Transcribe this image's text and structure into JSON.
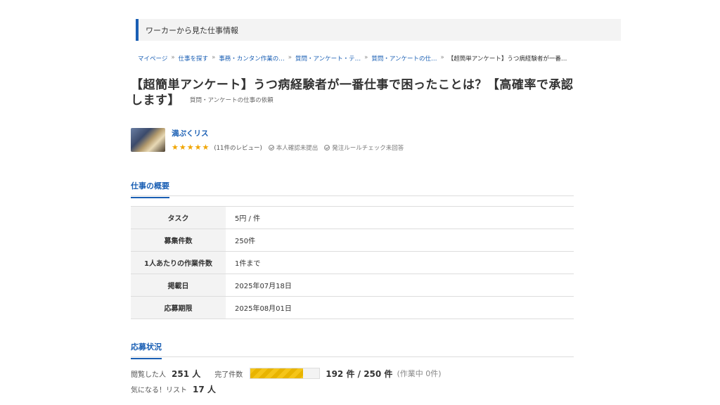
{
  "header": {
    "title": "ワーカーから見た仕事情報"
  },
  "breadcrumb": [
    "マイページ",
    "仕事を探す",
    "事務・カンタン作業の…",
    "質問・アンケート・テ…",
    "質問・アンケートの仕…",
    "【超簡単アンケート】うつ病経験者が一番…"
  ],
  "job": {
    "title": "【超簡単アンケート】うつ病経験者が一番仕事で困ったことは？【高確率で承認します】",
    "category": "質問・アンケートの仕事の依頼"
  },
  "client": {
    "name": "満ぷくリス",
    "stars": "★★★★★",
    "rating": 5,
    "reviews": "(11件のレビュー)",
    "identity_status": "本人確認未提出",
    "rule_status": "発注ルールチェック未回答"
  },
  "overview": {
    "heading": "仕事の概要",
    "rows": [
      {
        "label": "タスク",
        "value": "5円 / 件"
      },
      {
        "label": "募集件数",
        "value": "250件"
      },
      {
        "label": "1人あたりの作業件数",
        "value": "1件まで"
      },
      {
        "label": "掲載日",
        "value": "2025年07月18日"
      },
      {
        "label": "応募期限",
        "value": "2025年08月01日"
      }
    ]
  },
  "status": {
    "heading": "応募状況",
    "views_label": "閲覧した人",
    "views": "251 人",
    "completed_label": "完了件数",
    "progress_fraction": 0.768,
    "completed_text": "192 件 / 250 件",
    "in_progress_text": "(作業中 0件)",
    "favorites_label": "気になる！リスト",
    "favorites": "17 人"
  },
  "colors": {
    "accent": "#1a5fb4",
    "star": "#f0a500",
    "progress": "#f5c518"
  }
}
